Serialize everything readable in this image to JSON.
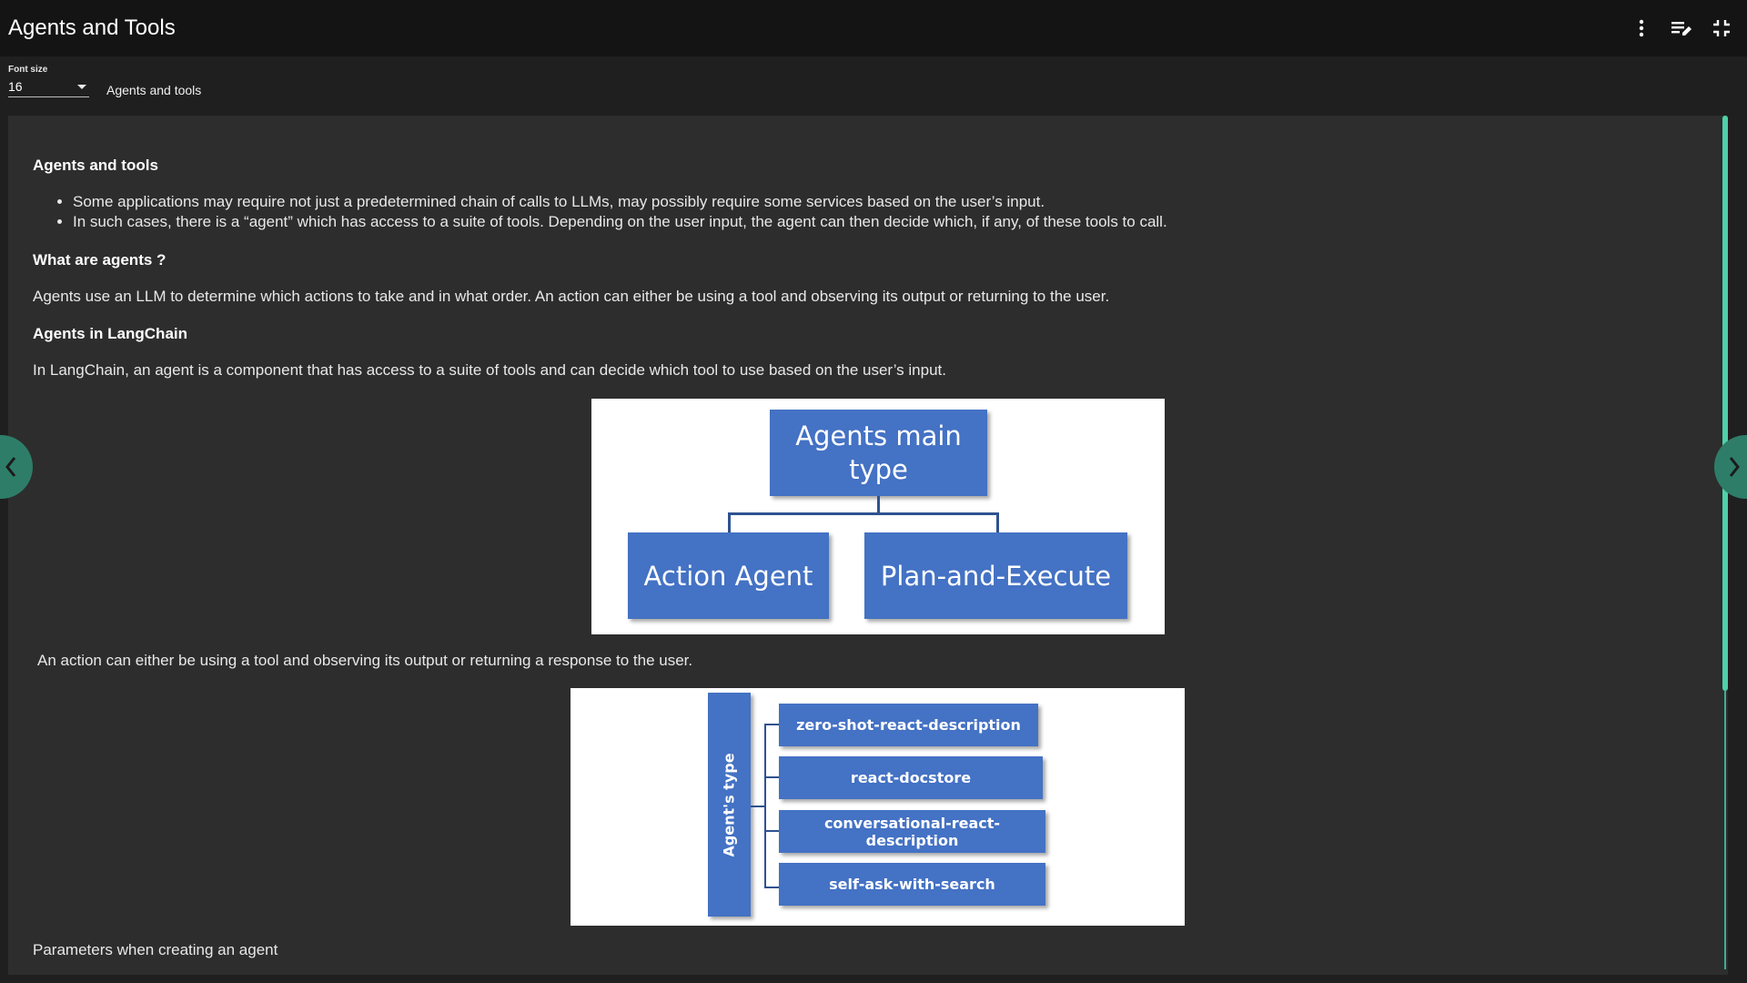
{
  "window": {
    "title": "Agents and Tools"
  },
  "toolbar": {
    "font_size_label": "Font size",
    "font_size_value": "16",
    "breadcrumb": "Agents and tools"
  },
  "content": {
    "heading1": "Agents and tools",
    "bullets": [
      "Some applications may require not just a predetermined chain of calls to LLMs, may possibly require some services based on the user’s input.",
      "In such cases, there is a “agent” which has access to a suite of tools. Depending on the user input, the agent can then decide which, if any, of these tools to call."
    ],
    "heading2": "What are agents ?",
    "para1": "Agents use an LLM to determine which actions to take and in what order. An action can either be using a tool and observing its output or returning to the user.",
    "heading3": "Agents in LangChain",
    "para2": "In LangChain, an agent is a component that has access to a suite of tools and can decide which tool to use based on the user’s input.",
    "diagram1": {
      "top": "Agents main type",
      "left": "Action Agent",
      "right": "Plan-and-Execute"
    },
    "para3": "An action can either be using a tool and observing its output or returning a response to the user.",
    "diagram2": {
      "side": "Agent's type",
      "items": [
        "zero-shot-react-description",
        "react-docstore",
        "conversational-react-description",
        "self-ask-with-search"
      ]
    },
    "para4": "Parameters when creating an agent"
  },
  "colors": {
    "accent": "#4fd0a8",
    "box": "#4472c4",
    "nav": "#2e7d68"
  },
  "icons": {
    "menu": "more-vert-icon",
    "edit": "edit-note-icon",
    "collapse": "fullscreen-exit-icon",
    "prev": "chevron-left-icon",
    "next": "chevron-right-icon"
  }
}
